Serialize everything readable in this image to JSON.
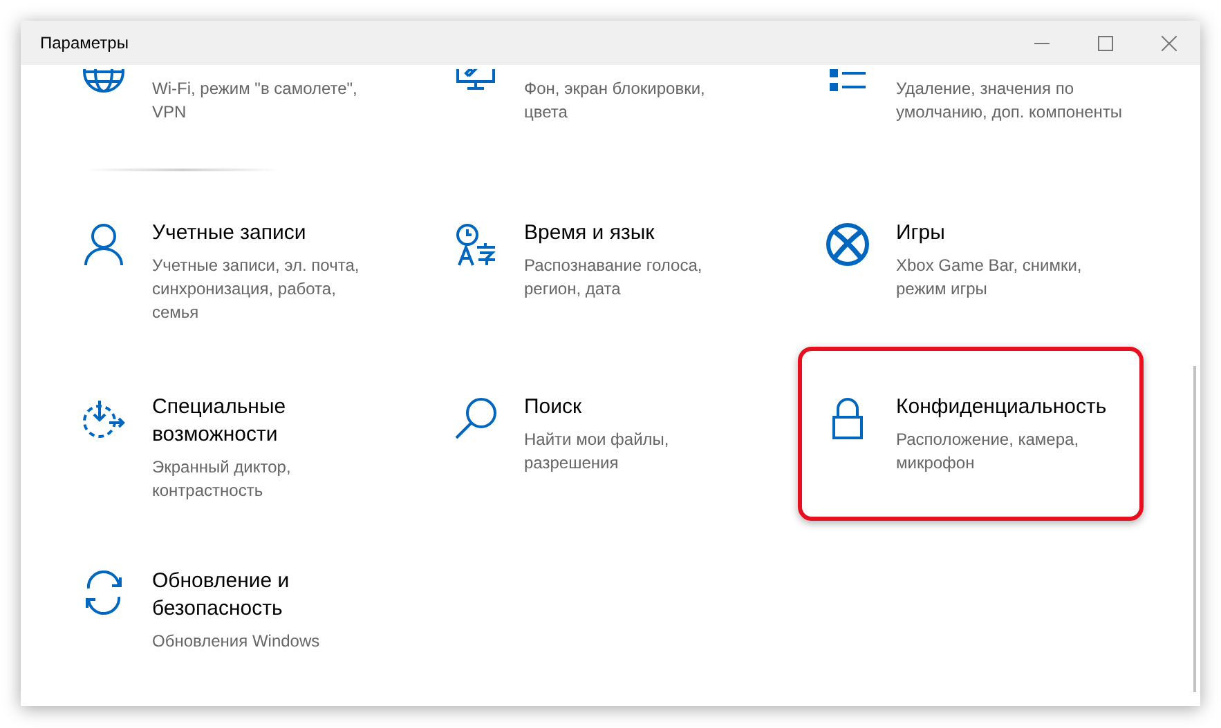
{
  "window": {
    "title": "Параметры"
  },
  "items": [
    {
      "description": "Wi-Fi, режим \"в самолете\", VPN",
      "highlighted": false
    },
    {
      "description": "Фон, экран блокировки, цвета",
      "highlighted": false
    },
    {
      "description": "Удаление, значения по умолчанию, доп. компоненты",
      "highlighted": false
    },
    {
      "title": "Учетные записи",
      "description": "Учетные записи, эл. почта, синхронизация, работа, семья",
      "highlighted": false
    },
    {
      "title": "Время и язык",
      "description": "Распознавание голоса, регион, дата",
      "highlighted": false
    },
    {
      "title": "Игры",
      "description": "Xbox Game Bar, снимки, режим игры",
      "highlighted": false
    },
    {
      "title": "Специальные возможности",
      "description": "Экранный диктор, контрастность",
      "highlighted": false
    },
    {
      "title": "Поиск",
      "description": "Найти мои файлы, разрешения",
      "highlighted": false
    },
    {
      "title": "Конфиденциальность",
      "description": "Расположение, камера, микрофон",
      "highlighted": true
    },
    {
      "title": "Обновление и безопасность",
      "description": "Обновления Windows",
      "highlighted": false
    }
  ]
}
